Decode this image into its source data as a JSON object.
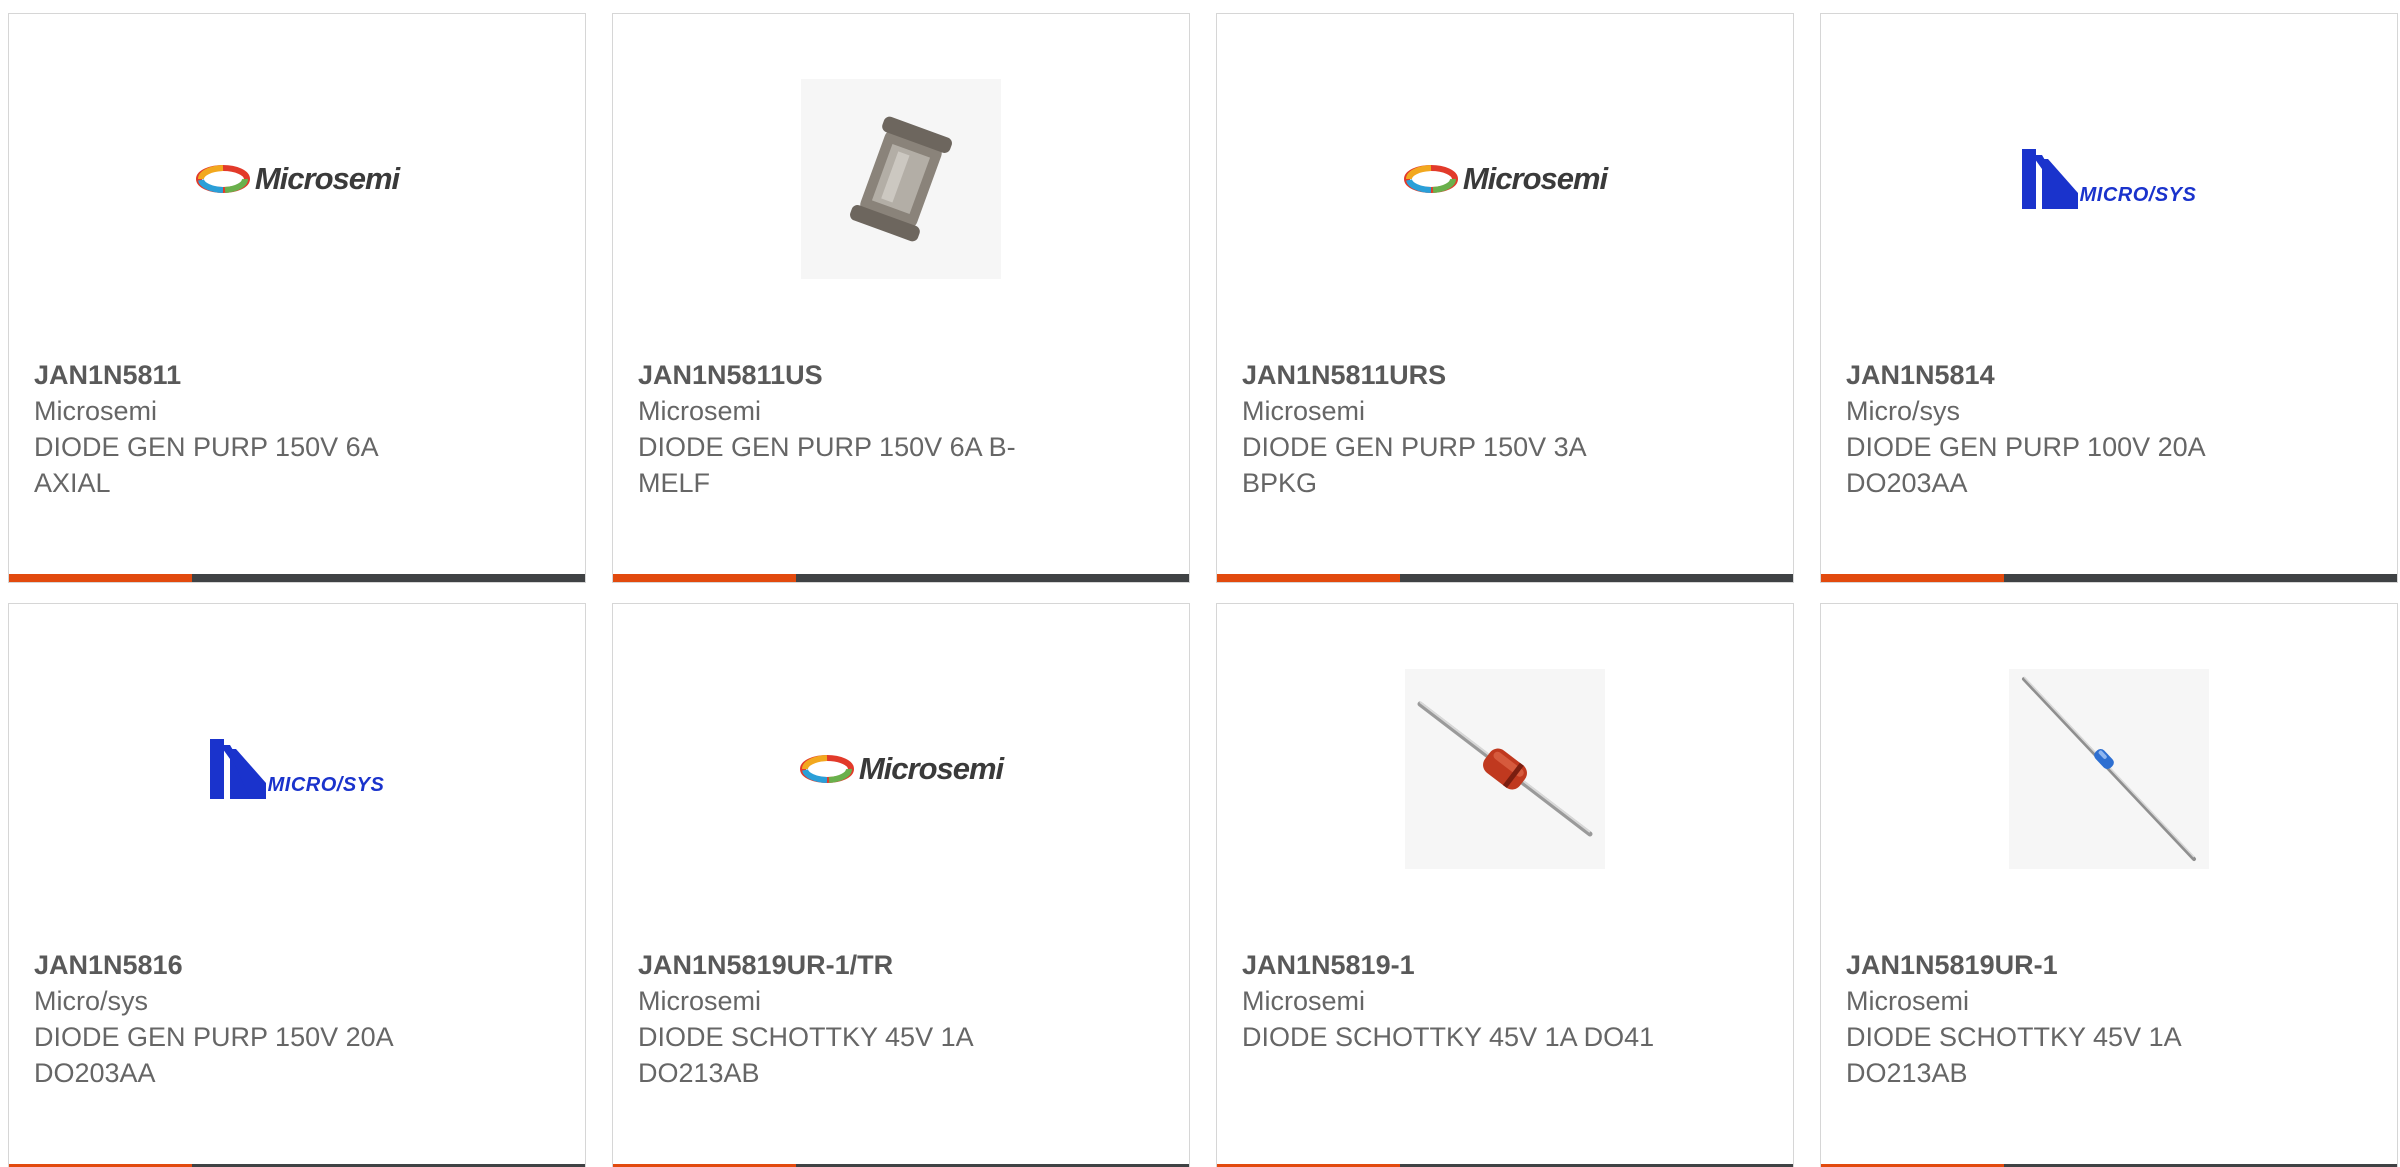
{
  "products": [
    {
      "part": "JAN1N5811",
      "manufacturer": "Microsemi",
      "description": "DIODE GEN PURP 150V 6A AXIAL",
      "image": "microsemi-logo"
    },
    {
      "part": "JAN1N5811US",
      "manufacturer": "Microsemi",
      "description": "DIODE GEN PURP 150V 6A B-MELF",
      "image": "melf-diode-photo"
    },
    {
      "part": "JAN1N5811URS",
      "manufacturer": "Microsemi",
      "description": "DIODE GEN PURP 150V 3A BPKG",
      "image": "microsemi-logo"
    },
    {
      "part": "JAN1N5814",
      "manufacturer": "Micro/sys",
      "description": "DIODE GEN PURP 100V 20A DO203AA",
      "image": "microsys-logo"
    },
    {
      "part": "JAN1N5816",
      "manufacturer": "Micro/sys",
      "description": "DIODE GEN PURP 150V 20A DO203AA",
      "image": "microsys-logo"
    },
    {
      "part": "JAN1N5819UR-1/TR",
      "manufacturer": "Microsemi",
      "description": "DIODE SCHOTTKY 45V 1A DO213AB",
      "image": "microsemi-logo"
    },
    {
      "part": "JAN1N5819-1",
      "manufacturer": "Microsemi",
      "description": "DIODE SCHOTTKY 45V 1A DO41",
      "image": "do41-diode-photo"
    },
    {
      "part": "JAN1N5819UR-1",
      "manufacturer": "Microsemi",
      "description": "DIODE SCHOTTKY 45V 1A DO213AB",
      "image": "glass-diode-photo"
    }
  ],
  "logos": {
    "microsemi": "Microsemi",
    "microsys": "MICRO/SYS"
  },
  "colors": {
    "accent": "#e24a0e",
    "bar": "#3f4244",
    "microsys_blue": "#1a33cc"
  }
}
